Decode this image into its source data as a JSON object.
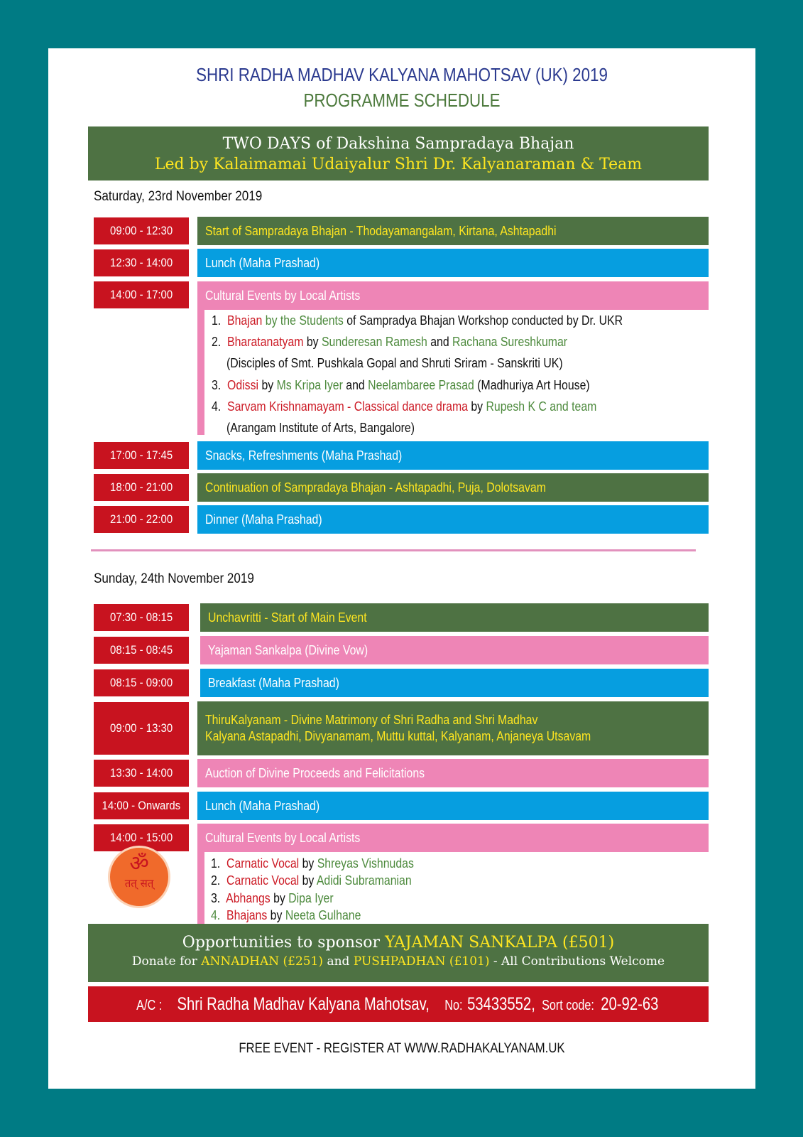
{
  "header": {
    "title": "SHRI RADHA MADHAV KALYANA MAHOTSAV (UK) 2019",
    "subtitle": "PROGRAMME SCHEDULE"
  },
  "banner": {
    "line1": "TWO DAYS of Dakshina Sampradaya Bhajan",
    "line2": "Led by Kalaimamai  Udaiyalur Shri Dr. Kalyanaraman  & Team"
  },
  "saturday": {
    "heading": "Saturday, 23rd November 2019",
    "rows": [
      {
        "time": "09:00  - 12:30",
        "event": "Start of Sampradaya Bhajan - Thodayamangalam, Kirtana, Ashtapadhi"
      },
      {
        "time": "12:30 - 14:00",
        "event": "Lunch  (Maha Prashad)"
      },
      {
        "time": "14:00 - 17:00",
        "event": "Cultural Events by Local Artists"
      },
      {
        "time": "17:00 - 17:45",
        "event": "Snacks, Refreshments  (Maha Prashad)"
      },
      {
        "time": "18:00 - 21:00",
        "event": "Continuation of Sampradaya Bhajan - Ashtapadhi, Puja, Dolotsavam"
      },
      {
        "time": "21:00 - 22:00",
        "event": "Dinner (Maha Prashad)"
      }
    ],
    "cultural": [
      {
        "num": "1.",
        "a": "Bhajan",
        "b": " by the  Students",
        "c": " of Sampradya Bhajan Workshop conducted by Dr. UKR"
      },
      {
        "num": "2.",
        "a": "Bharatanatyam",
        "b": "  by ",
        "c": "Sunderesan Ramesh",
        "d": " and ",
        "e": "Rachana Sureshkumar",
        "note": "(Disciples of Smt. Pushkala Gopal and Shruti Sriram - Sanskriti UK)"
      },
      {
        "num": "3.",
        "a": "Odissi",
        "b": "  by ",
        "c": "Ms Kripa Iyer",
        "d": " and ",
        "e": "Neelambaree Prasad",
        "f": " (Madhuriya Art House)"
      },
      {
        "num": "4.",
        "a": "Sarvam Krishnamayam  - Classical dance drama",
        "b": " by ",
        "c": "Rupesh K C and team",
        "note": "(Arangam Institute of Arts, Bangalore)"
      }
    ]
  },
  "sunday": {
    "heading": "Sunday, 24th  November 2019",
    "rows": [
      {
        "time": "07:30 - 08:15",
        "event": "Unchavritti - Start of Main Event"
      },
      {
        "time": "08:15 - 08:45",
        "event": "Yajaman Sankalpa (Divine Vow)"
      },
      {
        "time": "08:15 - 09:00",
        "event": "Breakfast (Maha Prashad)"
      },
      {
        "time": "09:00 - 13:30",
        "event_a": "ThiruKalyanam",
        "event_b": "  - Divine Matrimony of Shri Radha and Shri Madhav",
        "event_c": "Kalyana Astapadhi, Divyanamam, Muttu kuttal, Kalyanam, Anjaneya Utsavam"
      },
      {
        "time": "13:30 - 14:00",
        "event": "Auction of Divine Proceeds and Felicitations"
      },
      {
        "time": "14:00 - Onwards",
        "event": "Lunch (Maha Prashad)"
      },
      {
        "time": "14:00 - 15:00",
        "event": "Cultural Events by Local Artists"
      }
    ],
    "cultural": [
      {
        "num": "1.",
        "a": "Carnatic Vocal",
        "b": " by  ",
        "c": "Shreyas Vishnudas"
      },
      {
        "num": "2.",
        "a": "Carnatic Vocal",
        "b": " by  ",
        "c": "Adidi Subramanian"
      },
      {
        "num": "3.",
        "a": "Abhangs",
        "b": "  by ",
        "c": "Dipa Iyer"
      },
      {
        "num": "4.",
        "a": "Bhajans",
        "b": " by  ",
        "c": "Neeta Gulhane"
      }
    ]
  },
  "om_logo": {
    "symbol": "ॐ",
    "text": "तत् सत्"
  },
  "sponsor": {
    "l1a": "Opportunities to sponsor  ",
    "l1b": "YAJAMAN SANKALPA  (£501)",
    "l2a": "Donate for ",
    "l2b": "ANNADHAN (£251)",
    "l2c": "  and ",
    "l2d": "PUSHPADHAN (£101)",
    "l2e": "  - All Contributions Welcome"
  },
  "account": {
    "a": "A/C : ",
    "b": "Shri Radha Madhav Kalyana Mahotsav,",
    "c": "  No:  ",
    "d": "53433552,",
    "e": "  Sort code: ",
    "f": "20-92-63"
  },
  "footer": "FREE EVENT - REGISTER  AT WWW.RADHAKALYANAM.UK",
  "colors": {
    "background": "#007b84",
    "green": "#4e7243",
    "blue": "#069ee0",
    "pink": "#ee85b6",
    "red": "#c8131f",
    "yellow": "#ffe620"
  }
}
